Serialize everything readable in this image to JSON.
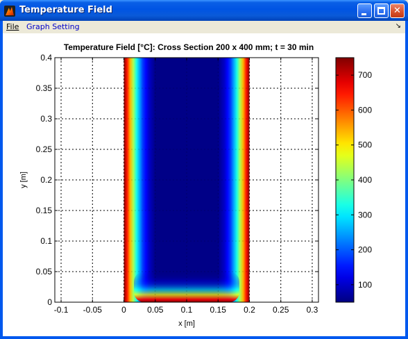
{
  "window": {
    "title": "Temperature Field"
  },
  "menu": {
    "file": "File",
    "graph_setting": "Graph Setting",
    "dock_glyph": "↘"
  },
  "chart_data": {
    "type": "heatmap",
    "title": "Temperature Field [°C]: Cross Section 200 x 400 mm; t = 30 min",
    "xlabel": "x [m]",
    "ylabel": "y [m]",
    "xlim": [
      -0.11,
      0.31
    ],
    "ylim": [
      0,
      0.4
    ],
    "xticks": [
      -0.1,
      -0.05,
      0,
      0.05,
      0.1,
      0.15,
      0.2,
      0.25,
      0.3
    ],
    "xtick_labels": [
      "-0.1",
      "-0.05",
      "0",
      "0.05",
      "0.1",
      "0.15",
      "0.2",
      "0.25",
      "0.3"
    ],
    "yticks": [
      0,
      0.05,
      0.1,
      0.15,
      0.2,
      0.25,
      0.3,
      0.35,
      0.4
    ],
    "ytick_labels": [
      "0",
      "0.05",
      "0.1",
      "0.15",
      "0.2",
      "0.25",
      "0.3",
      "0.35",
      "0.4"
    ],
    "grid": true,
    "colormap": "jet",
    "section": {
      "x_range": [
        0,
        0.2
      ],
      "y_range": [
        0,
        0.4
      ],
      "heated_faces": [
        "left",
        "right",
        "bottom"
      ]
    },
    "temperature_profile": {
      "distance_from_face_m": [
        0,
        0.005,
        0.01,
        0.015,
        0.02,
        0.025,
        0.03,
        0.04,
        0.05
      ],
      "temperature_c": [
        750,
        650,
        540,
        430,
        330,
        250,
        180,
        100,
        55
      ]
    },
    "colorbar": {
      "range": [
        50,
        750
      ],
      "ticks": [
        100,
        200,
        300,
        400,
        500,
        600,
        700
      ],
      "tick_labels": [
        "100",
        "200",
        "300",
        "400",
        "500",
        "600",
        "700"
      ]
    }
  }
}
